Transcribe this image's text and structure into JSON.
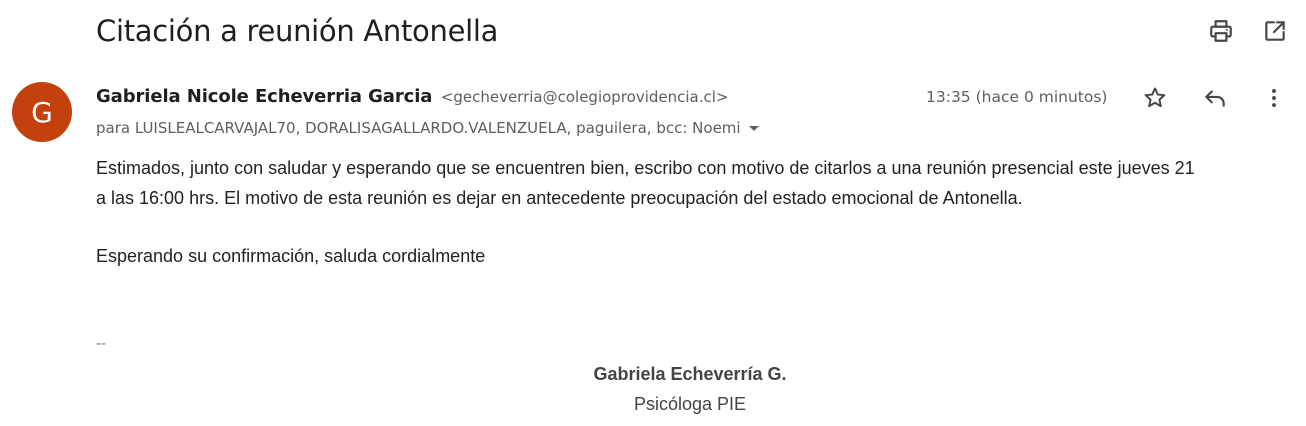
{
  "email": {
    "subject": "Citación a reunión Antonella",
    "sender": {
      "avatar_initial": "G",
      "avatar_color": "#c2410c",
      "name": "Gabriela Nicole Echeverria Garcia",
      "email": "<gecheverria@colegioprovidencia.cl>"
    },
    "time": "13:35 (hace 0 minutos)",
    "recipients": "para LUISLEALCARVAJAL70, DORALISAGALLARDO.VALENZUELA, paguilera, bcc: Noemi",
    "body": {
      "line1": "Estimados, junto con saludar y esperando que se encuentren bien, escribo con motivo de citarlos a una reunión presencial este jueves 21",
      "line2": "a las 16:00 hrs. El motivo de esta reunión es dejar en antecedente preocupación del estado emocional de Antonella.",
      "line3": "Esperando su confirmación, saluda cordialmente"
    },
    "signature": {
      "separator": "--",
      "name": "Gabriela Echeverría G.",
      "role": "Psicóloga PIE"
    }
  },
  "icons": {
    "print": "print-icon",
    "open_new_window": "open-in-new-window-icon",
    "star": "star-icon",
    "reply": "reply-icon",
    "more": "more-vert-icon",
    "expand_recipients": "caret-down-icon"
  }
}
